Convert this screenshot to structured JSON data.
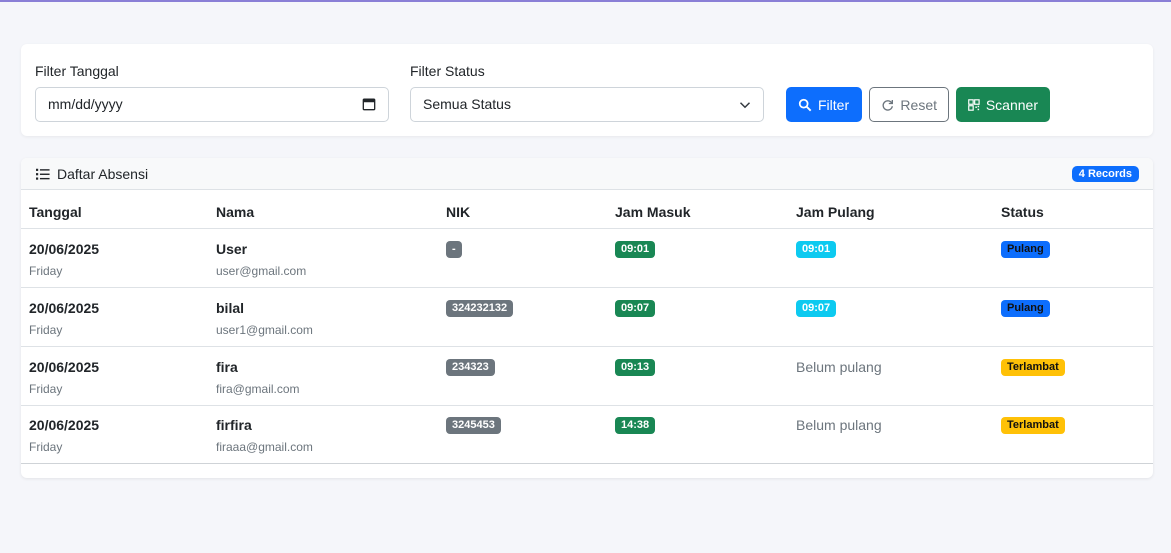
{
  "filters": {
    "date_label": "Filter Tanggal",
    "date_placeholder": "mm/dd/yyyy",
    "status_label": "Filter Status",
    "status_selected": "Semua Status",
    "filter_button": "Filter",
    "reset_button": "Reset",
    "scanner_button": "Scanner"
  },
  "table": {
    "title": "Daftar Absensi",
    "records_badge": "4 Records",
    "columns": [
      "Tanggal",
      "Nama",
      "NIK",
      "Jam Masuk",
      "Jam Pulang",
      "Status"
    ],
    "rows": [
      {
        "date": "20/06/2025",
        "day": "Friday",
        "name": "User",
        "email": "user@gmail.com",
        "nik": "-",
        "jam_masuk": "09:01",
        "jam_pulang": "09:01",
        "status": "Pulang"
      },
      {
        "date": "20/06/2025",
        "day": "Friday",
        "name": "bilal",
        "email": "user1@gmail.com",
        "nik": "324232132",
        "jam_masuk": "09:07",
        "jam_pulang": "09:07",
        "status": "Pulang"
      },
      {
        "date": "20/06/2025",
        "day": "Friday",
        "name": "fira",
        "email": "fira@gmail.com",
        "nik": "234323",
        "jam_masuk": "09:13",
        "jam_pulang": "Belum pulang",
        "status": "Terlambat"
      },
      {
        "date": "20/06/2025",
        "day": "Friday",
        "name": "firfira",
        "email": "firaaa@gmail.com",
        "nik": "3245453",
        "jam_masuk": "14:38",
        "jam_pulang": "Belum pulang",
        "status": "Terlambat"
      }
    ]
  },
  "colors": {
    "primary": "#0d6efd",
    "success": "#198754",
    "info": "#0dcaf0",
    "warning": "#ffc107",
    "secondary": "#6c757d"
  },
  "icons": {
    "calendar": "calendar-icon",
    "chevron": "chevron-down-icon",
    "filter": "search-icon",
    "reset": "refresh-icon",
    "scanner": "qrcode-icon",
    "list": "list-icon"
  }
}
